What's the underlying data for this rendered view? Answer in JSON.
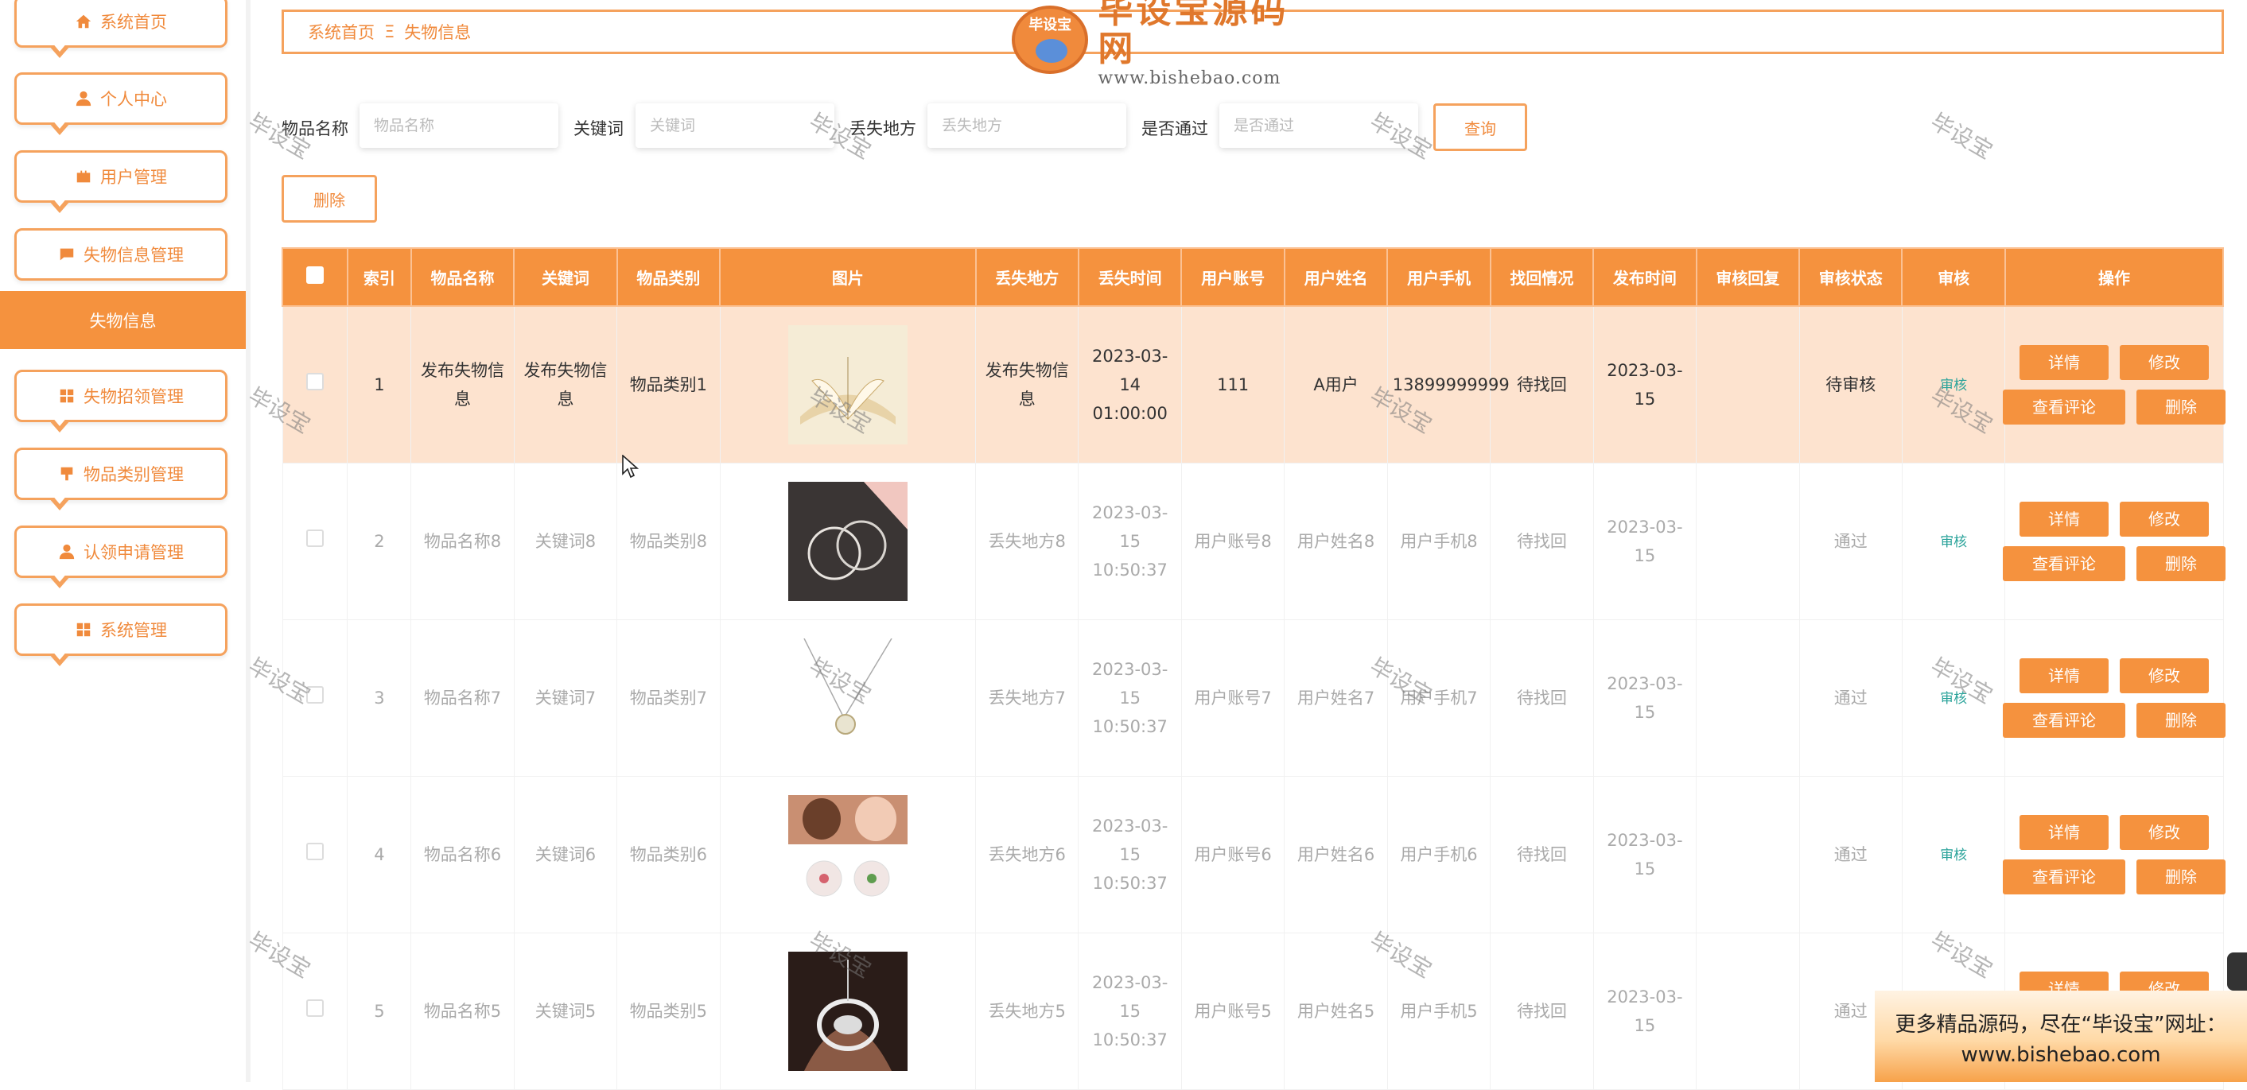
{
  "sidebar": {
    "items": [
      {
        "label": "系统首页",
        "icon": "home-icon"
      },
      {
        "label": "个人中心",
        "icon": "user-icon"
      },
      {
        "label": "用户管理",
        "icon": "briefcase-icon"
      },
      {
        "label": "失物信息管理",
        "icon": "message-icon"
      },
      {
        "label": "失物招领管理",
        "icon": "grid-icon"
      },
      {
        "label": "物品类别管理",
        "icon": "tag-icon"
      },
      {
        "label": "认领申请管理",
        "icon": "user-icon"
      },
      {
        "label": "系统管理",
        "icon": "grid-icon"
      }
    ],
    "active_item": "失物信息"
  },
  "breadcrumb": {
    "home": "系统首页",
    "separator": "Ξ",
    "current": "失物信息"
  },
  "logo": {
    "badge": "毕设宝",
    "title": "毕设宝源码网",
    "url": "www.bishebao.com"
  },
  "search": {
    "fields": [
      {
        "label": "物品名称",
        "placeholder": "物品名称"
      },
      {
        "label": "关键词",
        "placeholder": "关键词"
      },
      {
        "label": "丢失地方",
        "placeholder": "丢失地方"
      },
      {
        "label": "是否通过",
        "placeholder": "是否通过"
      }
    ],
    "query_button": "查询",
    "delete_button": "删除"
  },
  "table": {
    "headers": [
      "索引",
      "物品名称",
      "关键词",
      "物品类别",
      "图片",
      "丢失地方",
      "丢失时间",
      "用户账号",
      "用户姓名",
      "用户手机",
      "找回情况",
      "发布时间",
      "审核回复",
      "审核状态",
      "审核",
      "操作"
    ],
    "rows": [
      {
        "index": "1",
        "name": "发布失物信息",
        "keyword": "发布失物信息",
        "category": "物品类别1",
        "image": "book-photo",
        "place": "发布失物信息",
        "lost_time": "2023-03-14 01:00:00",
        "account": "111",
        "username": "A用户",
        "phone": "13899999999",
        "found": "待找回",
        "publish": "2023-03-15",
        "reply": "",
        "status": "待审核",
        "audit": "审核"
      },
      {
        "index": "2",
        "name": "物品名称8",
        "keyword": "关键词8",
        "category": "物品类别8",
        "image": "hoop-earrings-photo",
        "place": "丢失地方8",
        "lost_time": "2023-03-15 10:50:37",
        "account": "用户账号8",
        "username": "用户姓名8",
        "phone": "用户手机8",
        "found": "待找回",
        "publish": "2023-03-15",
        "reply": "",
        "status": "通过",
        "audit": "审核"
      },
      {
        "index": "3",
        "name": "物品名称7",
        "keyword": "关键词7",
        "category": "物品类别7",
        "image": "pendant-necklace-photo",
        "place": "丢失地方7",
        "lost_time": "2023-03-15 10:50:37",
        "account": "用户账号7",
        "username": "用户姓名7",
        "phone": "用户手机7",
        "found": "待找回",
        "publish": "2023-03-15",
        "reply": "",
        "status": "通过",
        "audit": "审核"
      },
      {
        "index": "4",
        "name": "物品名称6",
        "keyword": "关键词6",
        "category": "物品类别6",
        "image": "stud-earrings-photo",
        "place": "丢失地方6",
        "lost_time": "2023-03-15 10:50:37",
        "account": "用户账号6",
        "username": "用户姓名6",
        "phone": "用户手机6",
        "found": "待找回",
        "publish": "2023-03-15",
        "reply": "",
        "status": "通过",
        "audit": "审核"
      },
      {
        "index": "5",
        "name": "物品名称5",
        "keyword": "关键词5",
        "category": "物品类别5",
        "image": "crystal-pendant-photo",
        "place": "丢失地方5",
        "lost_time": "2023-03-15 10:50:37",
        "account": "用户账号5",
        "username": "用户姓名5",
        "phone": "用户手机5",
        "found": "待找回",
        "publish": "2023-03-15",
        "reply": "",
        "status": "通过",
        "audit": "审核"
      }
    ],
    "row_actions": {
      "detail": "详情",
      "edit": "修改",
      "comments": "查看评论",
      "delete": "删除"
    }
  },
  "watermark": "毕设宝",
  "ad": {
    "line1": "更多精品源码，尽在“毕设宝”网址：",
    "line2": "www.bishebao.com"
  },
  "colors": {
    "accent": "#f5923e",
    "accent_border": "#f5a25d",
    "highlight_row": "#fde3cf",
    "audit_link": "#2aa39a"
  }
}
